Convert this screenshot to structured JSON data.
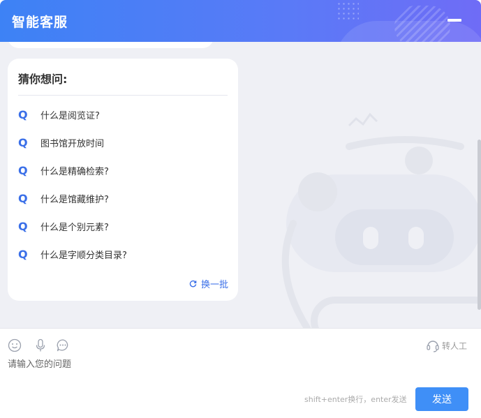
{
  "header": {
    "title": "智能客服",
    "minimize_icon": "minus-icon"
  },
  "suggestions": {
    "title": "猜你想问:",
    "q_mark": "Q",
    "items": [
      "什么是阅览证?",
      "图书馆开放时间",
      "什么是精确检索?",
      "什么是馆藏维护?",
      "什么是个别元素?",
      "什么是字顺分类目录?"
    ],
    "refresh_label": "换一批",
    "refresh_icon": "refresh-icon"
  },
  "composer": {
    "tools": [
      "emoji-icon",
      "microphone-icon",
      "chat-bubble-icon"
    ],
    "transfer_label": "转人工",
    "transfer_icon": "headset-icon",
    "placeholder": "请输入您的问题",
    "hint": "shift+enter换行，enter发送",
    "send_label": "发送"
  },
  "colors": {
    "header_start": "#3d82f5",
    "header_end": "#6f6cf6",
    "accent": "#3a6fe8",
    "send_button": "#3f8ff7",
    "chat_background": "#eff0f5"
  }
}
